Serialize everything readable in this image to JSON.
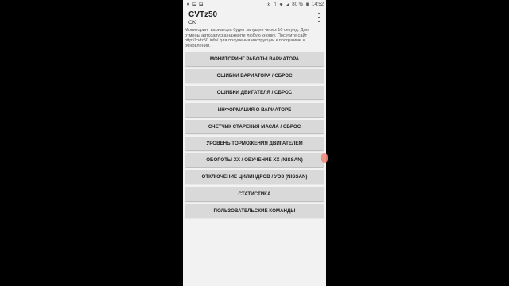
{
  "status_bar": {
    "battery": "80 %",
    "time": "14:52"
  },
  "app_bar": {
    "title": "CVTz50",
    "subtitle": "OK",
    "overflow_icon": "more-vert-icon"
  },
  "info_text": "Мониторинг вариатора будет запущен через 10 секунд. Для отмены автозапуска нажмите любую кнопку. Посетите сайт http://cvtz50.info/ для получения инструкции к программе и обновлений.",
  "buttons": [
    {
      "label": "МОНИТОРИНГ РАБОТЫ ВАРИАТОРА"
    },
    {
      "label": "ОШИБКИ ВАРИАТОРА / СБРОС"
    },
    {
      "label": "ОШИБКИ ДВИГАТЕЛЯ / СБРОС"
    },
    {
      "label": "ИНФОРМАЦИЯ О ВАРИАТОРЕ"
    },
    {
      "label": "СЧЕТЧИК СТАРЕНИЯ МАСЛА / СБРОС"
    },
    {
      "label": "УРОВЕНЬ ТОРМОЖЕНИЯ ДВИГАТЕЛЕМ"
    },
    {
      "label": "ОБОРОТЫ ХХ / ОБУЧЕНИЕ ХХ (NISSAN)"
    },
    {
      "label": "ОТКЛЮЧЕНИЕ ЦИЛИНДРОВ / УОЗ (NISSAN)"
    },
    {
      "label": "СТАТИСТИКА"
    },
    {
      "label": "ПОЛЬЗОВАТЕЛЬСКИЕ КОМАНДЫ"
    }
  ]
}
